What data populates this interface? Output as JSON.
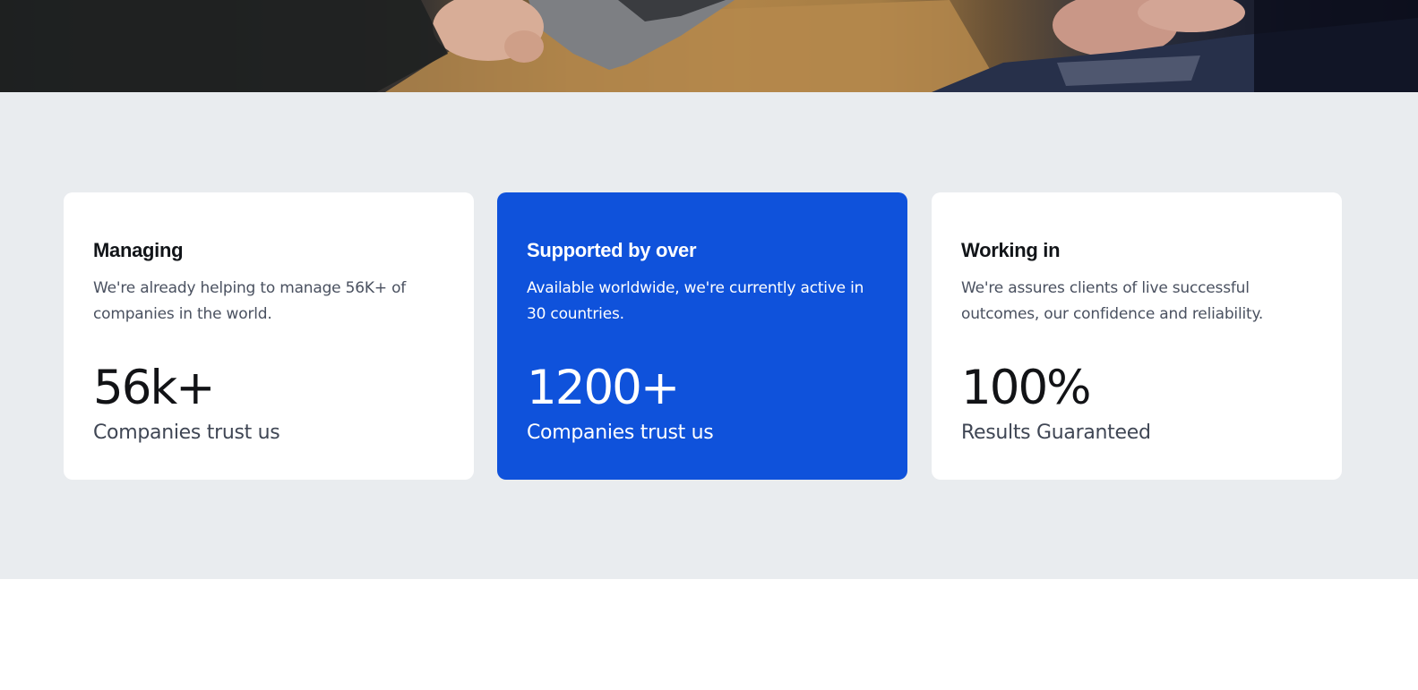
{
  "hero": {
    "image_icon": "photo-people-laptop-desk"
  },
  "stats": {
    "background_color": "#e9ecef",
    "accent_color": "#0f52db",
    "cards": [
      {
        "title": "Managing",
        "description": "We're already helping to manage 56K+ of companies in the world.",
        "value": "56k+",
        "label": "Companies trust us",
        "highlighted": false
      },
      {
        "title": "Supported by over",
        "description": "Available worldwide, we're currently active in 30 countries.",
        "value": "1200+",
        "label": "Companies trust us",
        "highlighted": true
      },
      {
        "title": "Working in",
        "description": "We're assures clients of live successful outcomes, our confidence and reliability.",
        "value": "100%",
        "label": "Results Guaranteed",
        "highlighted": false
      }
    ]
  }
}
